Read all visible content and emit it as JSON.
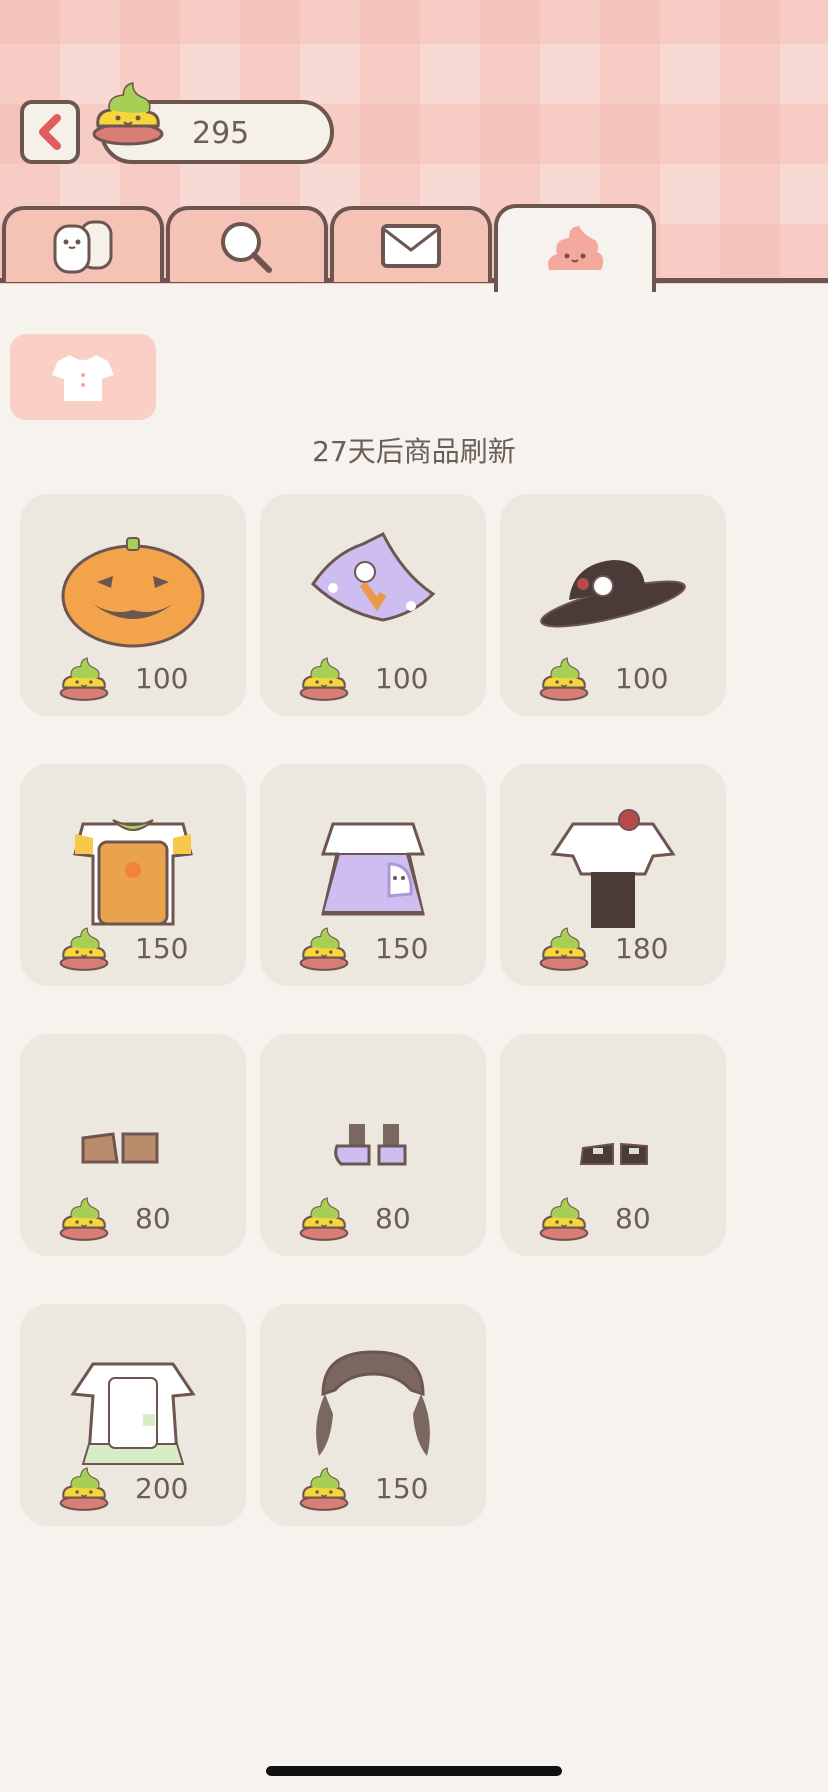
{
  "header": {
    "coin_balance": "295",
    "back_icon": "chevron-left-icon",
    "currency_icon": "poop-coin-icon"
  },
  "tabs": [
    {
      "icon": "friends-icon",
      "active": false
    },
    {
      "icon": "magnifier-icon",
      "active": false
    },
    {
      "icon": "mail-icon",
      "active": false
    },
    {
      "icon": "poop-shop-icon",
      "active": true
    }
  ],
  "filter": {
    "icon": "shirt-icon"
  },
  "shop": {
    "refresh_notice": "27天后商品刷新",
    "items": [
      {
        "icon": "pumpkin-hat-icon",
        "price": "100"
      },
      {
        "icon": "witch-hat-icon",
        "price": "100"
      },
      {
        "icon": "black-hat-icon",
        "price": "100"
      },
      {
        "icon": "pumpkin-overalls-icon",
        "price": "150"
      },
      {
        "icon": "ghost-dress-icon",
        "price": "150"
      },
      {
        "icon": "red-bow-outfit-icon",
        "price": "180"
      },
      {
        "icon": "brown-shoes-icon",
        "price": "80"
      },
      {
        "icon": "lavender-boots-icon",
        "price": "80"
      },
      {
        "icon": "black-shoes-icon",
        "price": "80"
      },
      {
        "icon": "maid-dress-icon",
        "price": "200"
      },
      {
        "icon": "brown-twintail-hair-icon",
        "price": "150"
      }
    ]
  },
  "colors": {
    "accent": "#f5c3b6",
    "outline": "#6d5550",
    "card": "#ede8df",
    "background": "#f6f3ee"
  }
}
